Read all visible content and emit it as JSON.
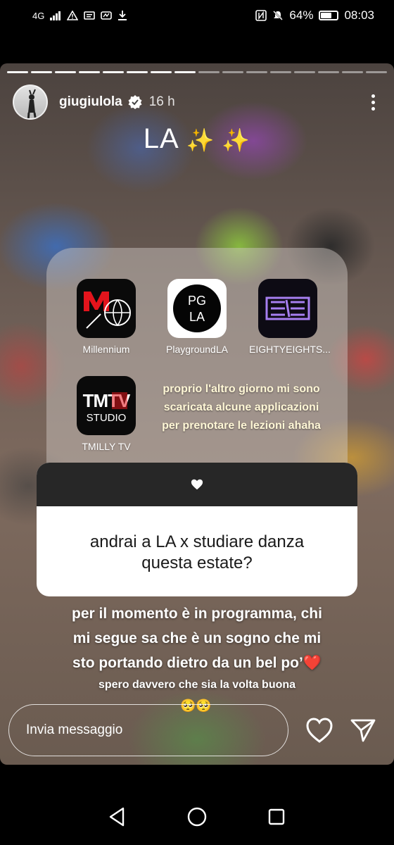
{
  "status_bar": {
    "network": "4G",
    "battery_percent": "64%",
    "battery_level": 0.64,
    "time": "08:03"
  },
  "story": {
    "progress_total": 16,
    "progress_done": 8,
    "username": "giugiulola",
    "time_ago": "16 h",
    "title": "LA",
    "title_sparkles": "✨ ✨"
  },
  "apps": [
    {
      "label": "Millennium",
      "icon": "millennium-app-icon"
    },
    {
      "label": "PlaygroundLA",
      "icon": "playgroundla-app-icon",
      "icon_text_top": "PG",
      "icon_text_bottom": "LA"
    },
    {
      "label": "EIGHTYEIGHTS...",
      "icon": "eightyeights-app-icon"
    },
    {
      "label": "TMILLY TV",
      "icon": "tmilly-tv-app-icon",
      "icon_text_top": "TMTV",
      "icon_text_bottom": "STUDIO"
    }
  ],
  "apps_caption": {
    "line1": "proprio l'altro giorno mi sono",
    "line2": "scaricata alcune applicazioni",
    "line3": "per prenotare le lezioni ahaha"
  },
  "question": {
    "icon": "heart-icon",
    "line1": "andrai a LA x studiare danza",
    "line2": "questa estate?"
  },
  "answer": {
    "line1": "per il momento è in programma, chi",
    "line2": "mi segue sa che è un sogno che mi",
    "line3": "sto portando dietro da un bel po’❤️"
  },
  "hope_text": "spero davvero che sia la volta buona",
  "hope_emojis": "🥺🥺",
  "reply": {
    "placeholder": "Invia messaggio"
  },
  "colors": {
    "caption": "#fff7d6",
    "question_header": "#272727",
    "accent_heart": "#e0232d"
  }
}
